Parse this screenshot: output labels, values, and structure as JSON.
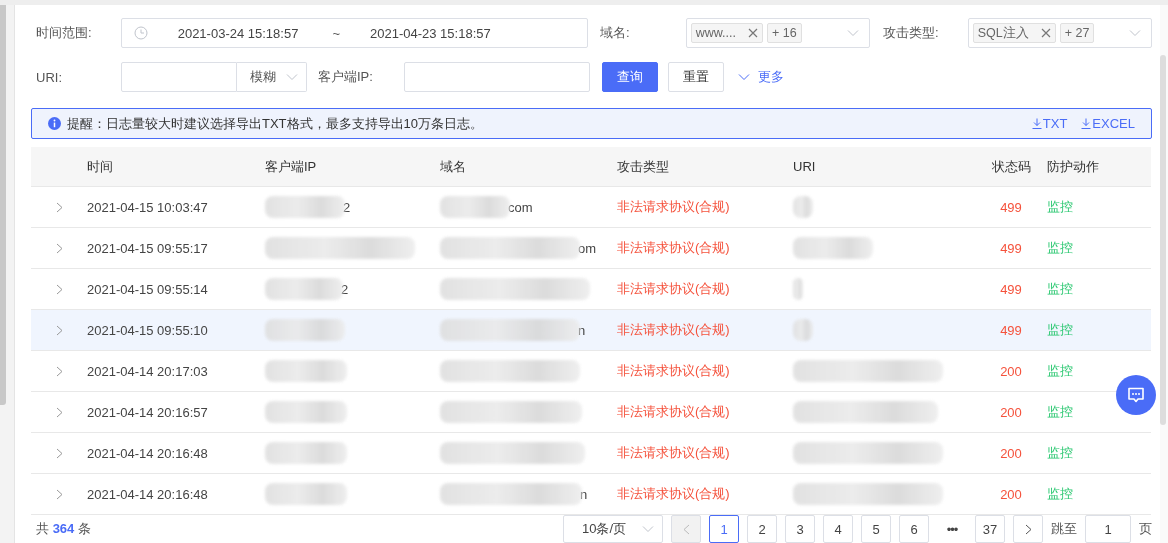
{
  "filters": {
    "time_range": {
      "label": "时间范围:",
      "start": "2021-03-24 15:18:57",
      "separator": "~",
      "end": "2021-04-23 15:18:57"
    },
    "domain": {
      "label": "域名:",
      "tags": [
        "www...."
      ],
      "more": "+ 16"
    },
    "attack_type": {
      "label": "攻击类型:",
      "tags": [
        "SQL注入"
      ],
      "more": "+ 27"
    },
    "uri": {
      "label": "URI:",
      "match_mode": "模糊"
    },
    "client_ip": {
      "label": "客户端IP:"
    },
    "buttons": [
      {
        "label": "查询",
        "kind": "primary"
      },
      {
        "label": "重置",
        "kind": "default"
      }
    ],
    "more_link": "更多"
  },
  "alert": {
    "text": "提醒：日志量较大时建议选择导出TXT格式，最多支持导出10万条日志。",
    "exports": [
      "TXT",
      "EXCEL"
    ]
  },
  "table": {
    "columns": [
      "时间",
      "客户端IP",
      "域名",
      "攻击类型",
      "URI",
      "状态码",
      "防护动作"
    ],
    "rows": [
      {
        "time": "2021-04-15 10:03:47",
        "ip_tail": "2",
        "domain_tail": "com",
        "attack": "非法请求协议(合规)",
        "status": "499",
        "action": "监控",
        "selected": false
      },
      {
        "time": "2021-04-15 09:55:17",
        "domain_tail": "om",
        "attack": "非法请求协议(合规)",
        "status": "499",
        "action": "监控",
        "selected": false
      },
      {
        "time": "2021-04-15 09:55:14",
        "ip_tail": "2",
        "attack": "非法请求协议(合规)",
        "status": "499",
        "action": "监控",
        "selected": false
      },
      {
        "time": "2021-04-15 09:55:10",
        "domain_tail": "n",
        "attack": "非法请求协议(合规)",
        "status": "499",
        "action": "监控",
        "selected": true
      },
      {
        "time": "2021-04-14 20:17:03",
        "attack": "非法请求协议(合规)",
        "status": "200",
        "action": "监控",
        "selected": false
      },
      {
        "time": "2021-04-14 20:16:57",
        "attack": "非法请求协议(合规)",
        "status": "200",
        "action": "监控",
        "selected": false
      },
      {
        "time": "2021-04-14 20:16:48",
        "attack": "非法请求协议(合规)",
        "status": "200",
        "action": "监控",
        "selected": false
      },
      {
        "time": "2021-04-14 20:16:48",
        "domain_tail": "n",
        "attack": "非法请求协议(合规)",
        "status": "200",
        "action": "监控",
        "selected": false
      }
    ]
  },
  "pagination": {
    "total_prefix": "共",
    "total": "364",
    "total_suffix": "条",
    "page_size": "10条/页",
    "pages": [
      {
        "label": "1",
        "selected": true
      },
      {
        "label": "2",
        "selected": false
      },
      {
        "label": "3",
        "selected": false
      },
      {
        "label": "4",
        "selected": false
      },
      {
        "label": "5",
        "selected": false
      },
      {
        "label": "6",
        "selected": false
      },
      {
        "label": "•••",
        "selected": false
      },
      {
        "label": "37",
        "selected": false
      }
    ],
    "prev_disabled": true,
    "jump_label": "跳至",
    "jump_value": "1",
    "jump_suffix": "页"
  }
}
